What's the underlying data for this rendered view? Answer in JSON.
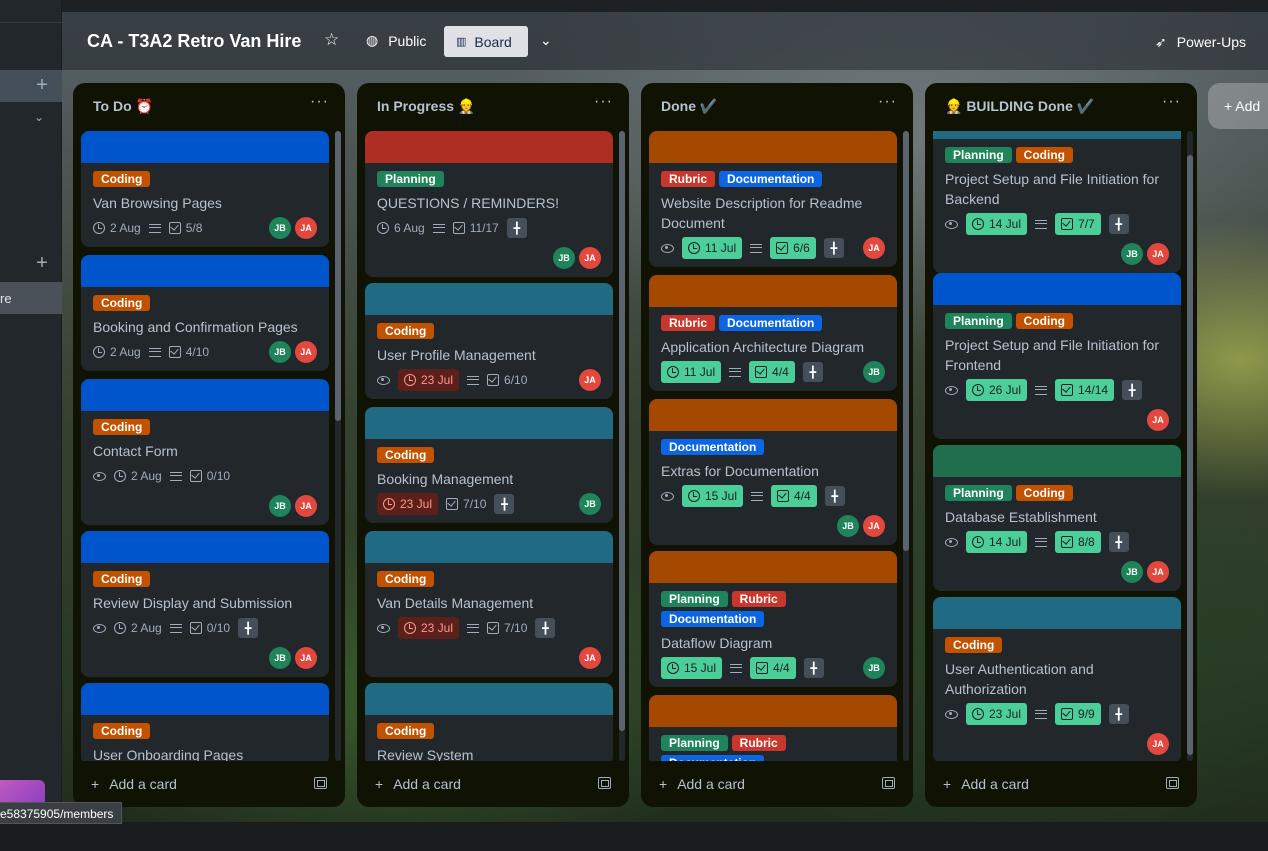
{
  "board": {
    "title": "CA - T3A2 Retro Van Hire",
    "visibility": "Public",
    "view": "Board",
    "powerups": "Power-Ups",
    "add_list": "+ Add"
  },
  "sidebar": {
    "partial_label": "re"
  },
  "status_url": "e58375905/members",
  "add_card_label": "Add a card",
  "colors": {
    "blue": "#0055cc",
    "red": "#ae2e24",
    "teal": "#206a83",
    "orange": "#a54800",
    "green": "#216e4e",
    "coding": "#c25100",
    "planning": "#1f845a",
    "rubric": "#c9372c",
    "documentation": "#0c66e4"
  },
  "lists": [
    {
      "title": "To Do ⏰",
      "cards": [
        {
          "cover": "blue",
          "labels": [
            "Coding"
          ],
          "title": "Van Browsing Pages",
          "watch": false,
          "due": "2 Aug",
          "due_style": "plain",
          "desc": true,
          "checklist": "5/8",
          "check_style": "plain",
          "pin": false,
          "members": [
            "JB",
            "JA"
          ],
          "members_newline": false
        },
        {
          "cover": "blue",
          "labels": [
            "Coding"
          ],
          "title": "Booking and Confirmation Pages",
          "watch": false,
          "due": "2 Aug",
          "due_style": "plain",
          "desc": true,
          "checklist": "4/10",
          "check_style": "plain",
          "pin": false,
          "members": [
            "JB",
            "JA"
          ],
          "members_newline": false
        },
        {
          "cover": "blue",
          "labels": [
            "Coding"
          ],
          "title": "Contact Form",
          "watch": true,
          "due": "2 Aug",
          "due_style": "plain",
          "desc": true,
          "checklist": "0/10",
          "check_style": "plain",
          "pin": false,
          "members": [
            "JB",
            "JA"
          ],
          "members_newline": true
        },
        {
          "cover": "blue",
          "labels": [
            "Coding"
          ],
          "title": "Review Display and Submission",
          "watch": true,
          "due": "2 Aug",
          "due_style": "plain",
          "desc": true,
          "checklist": "0/10",
          "check_style": "plain",
          "pin": true,
          "members": [
            "JB",
            "JA"
          ],
          "members_newline": true
        },
        {
          "cover": "blue",
          "labels": [
            "Coding"
          ],
          "title": "User Onboarding Pages",
          "watch": false,
          "due": "",
          "due_style": "plain",
          "desc": false,
          "checklist": "",
          "check_style": "plain",
          "pin": false,
          "members": [],
          "members_newline": false
        }
      ]
    },
    {
      "title": "In Progress 👷",
      "cards": [
        {
          "cover": "red",
          "labels": [
            "Planning"
          ],
          "title": "QUESTIONS / REMINDERS!",
          "watch": false,
          "due": "6 Aug",
          "due_style": "plain",
          "desc": true,
          "checklist": "11/17",
          "check_style": "plain",
          "pin": true,
          "members": [
            "JB",
            "JA"
          ],
          "members_newline": true
        },
        {
          "cover": "teal",
          "labels": [
            "Coding"
          ],
          "title": "User Profile Management",
          "watch": true,
          "due": "23 Jul",
          "due_style": "overdue",
          "desc": true,
          "checklist": "6/10",
          "check_style": "plain",
          "pin": false,
          "members": [
            "JA"
          ],
          "members_newline": false
        },
        {
          "cover": "teal",
          "labels": [
            "Coding"
          ],
          "title": "Booking Management",
          "watch": false,
          "due": "23 Jul",
          "due_style": "overdue",
          "desc": false,
          "checklist": "7/10",
          "check_style": "plain",
          "pin": true,
          "members": [
            "JB"
          ],
          "members_newline": false
        },
        {
          "cover": "teal",
          "labels": [
            "Coding"
          ],
          "title": "Van Details Management",
          "watch": true,
          "due": "23 Jul",
          "due_style": "overdue",
          "desc": true,
          "checklist": "7/10",
          "check_style": "plain",
          "pin": true,
          "members": [
            "JA"
          ],
          "members_newline": true
        },
        {
          "cover": "teal",
          "labels": [
            "Coding"
          ],
          "title": "Review System",
          "watch": false,
          "due": "",
          "due_style": "plain",
          "desc": false,
          "checklist": "",
          "check_style": "plain",
          "pin": false,
          "members": [],
          "members_newline": false
        }
      ]
    },
    {
      "title": "Done ✔️",
      "cards": [
        {
          "cover": "orange",
          "labels": [
            "Rubric",
            "Documentation"
          ],
          "title": "Website Description for Readme Document",
          "watch": true,
          "due": "11 Jul",
          "due_style": "complete",
          "desc": true,
          "checklist": "6/6",
          "check_style": "complete",
          "pin": true,
          "members": [
            "JA"
          ],
          "members_newline": false
        },
        {
          "cover": "orange",
          "labels": [
            "Rubric",
            "Documentation"
          ],
          "title": "Application Architecture Diagram",
          "watch": false,
          "due": "11 Jul",
          "due_style": "complete",
          "desc": true,
          "checklist": "4/4",
          "check_style": "complete",
          "pin": true,
          "members": [
            "JB"
          ],
          "members_newline": false
        },
        {
          "cover": "orange",
          "labels": [
            "Documentation"
          ],
          "title": "Extras for Documentation",
          "watch": true,
          "due": "15 Jul",
          "due_style": "complete",
          "desc": true,
          "checklist": "4/4",
          "check_style": "complete",
          "pin": true,
          "members": [
            "JB",
            "JA"
          ],
          "members_newline": true
        },
        {
          "cover": "orange",
          "labels": [
            "Planning",
            "Rubric",
            "Documentation"
          ],
          "title": "Dataflow Diagram",
          "watch": false,
          "due": "15 Jul",
          "due_style": "complete",
          "desc": true,
          "checklist": "4/4",
          "check_style": "complete",
          "pin": true,
          "members": [
            "JB"
          ],
          "members_newline": false
        },
        {
          "cover": "orange",
          "labels": [
            "Planning",
            "Rubric",
            "Documentation"
          ],
          "title": "",
          "watch": false,
          "due": "",
          "due_style": "plain",
          "desc": false,
          "checklist": "",
          "check_style": "plain",
          "pin": false,
          "members": [],
          "members_newline": false
        }
      ]
    },
    {
      "title": "👷 BUILDING Done ✔️",
      "cards": [
        {
          "cover": "teal",
          "labels": [
            "Planning",
            "Coding"
          ],
          "title": "Project Setup and File Initiation for Backend",
          "watch": true,
          "due": "14 Jul",
          "due_style": "complete",
          "desc": true,
          "checklist": "7/7",
          "check_style": "complete",
          "pin": true,
          "members": [
            "JB",
            "JA"
          ],
          "members_newline": true
        },
        {
          "cover": "blue",
          "labels": [
            "Planning",
            "Coding"
          ],
          "title": "Project Setup and File Initiation for Frontend",
          "watch": true,
          "due": "26 Jul",
          "due_style": "complete",
          "desc": true,
          "checklist": "14/14",
          "check_style": "complete",
          "pin": true,
          "members": [
            "JA"
          ],
          "members_newline": true
        },
        {
          "cover": "green",
          "labels": [
            "Planning",
            "Coding"
          ],
          "title": "Database Establishment",
          "watch": true,
          "due": "14 Jul",
          "due_style": "complete",
          "desc": true,
          "checklist": "8/8",
          "check_style": "complete",
          "pin": true,
          "members": [
            "JB",
            "JA"
          ],
          "members_newline": true
        },
        {
          "cover": "teal",
          "labels": [
            "Coding"
          ],
          "title": "User Authentication and Authorization",
          "watch": true,
          "due": "23 Jul",
          "due_style": "complete",
          "desc": true,
          "checklist": "9/9",
          "check_style": "complete",
          "pin": true,
          "members": [
            "JA"
          ],
          "members_newline": true
        }
      ]
    }
  ]
}
